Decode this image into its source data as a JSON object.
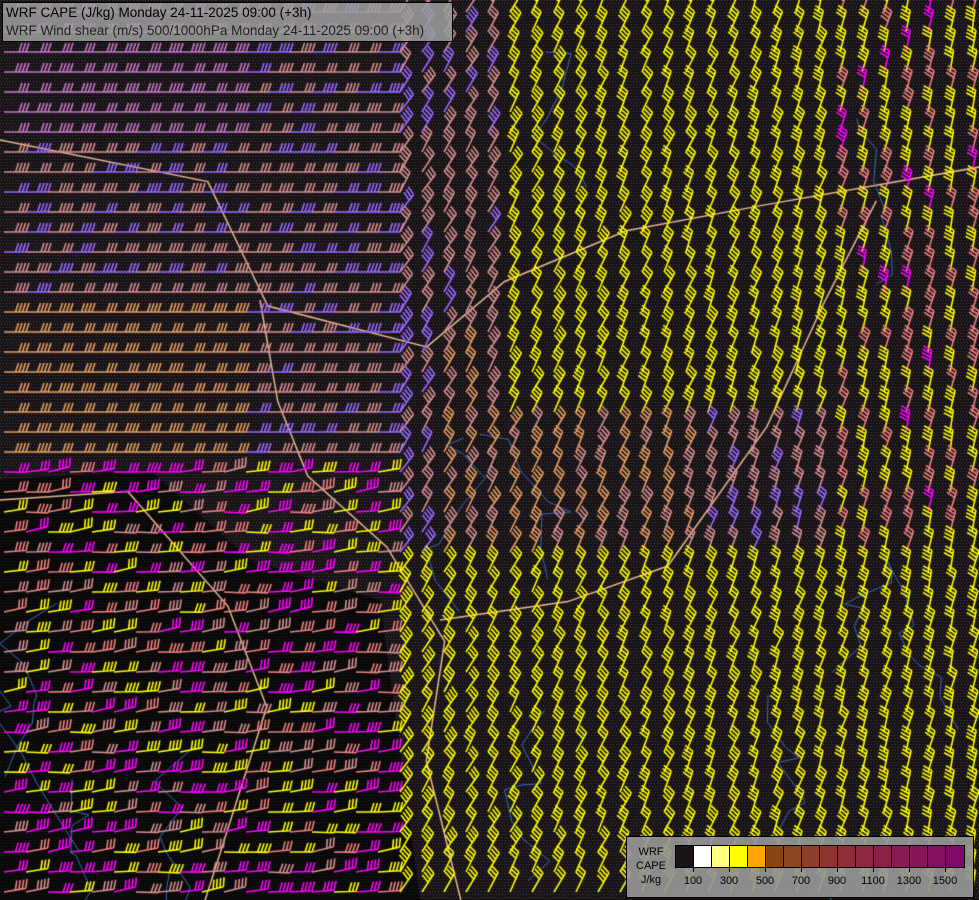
{
  "titles": {
    "line1": "WRF CAPE (J/kg) Monday 24-11-2025 09:00 (+3h)",
    "line2": "WRF Wind shear (m/s) 500/1000hPa Monday 24-11-2025 09:00 (+3h)"
  },
  "legend": {
    "label_lines": [
      "WRF",
      "CAPE",
      "J/kg"
    ],
    "colors": [
      "#1a1418",
      "#ffffff",
      "#ffff80",
      "#ffff00",
      "#ffa500",
      "#8b4513",
      "#8b4520",
      "#8e3e2a",
      "#8f3530",
      "#8e2e38",
      "#8c2840",
      "#8a2248",
      "#881c50",
      "#861658",
      "#841060",
      "#800868"
    ],
    "tick_labels": [
      "100",
      "300",
      "500",
      "700",
      "900",
      "1100",
      "1300",
      "1500"
    ]
  },
  "barb_colors": [
    "#ffff00",
    "#e8a060",
    "#f08080",
    "#ff00ff",
    "#c878c8",
    "#d89090",
    "#9a6aff"
  ]
}
